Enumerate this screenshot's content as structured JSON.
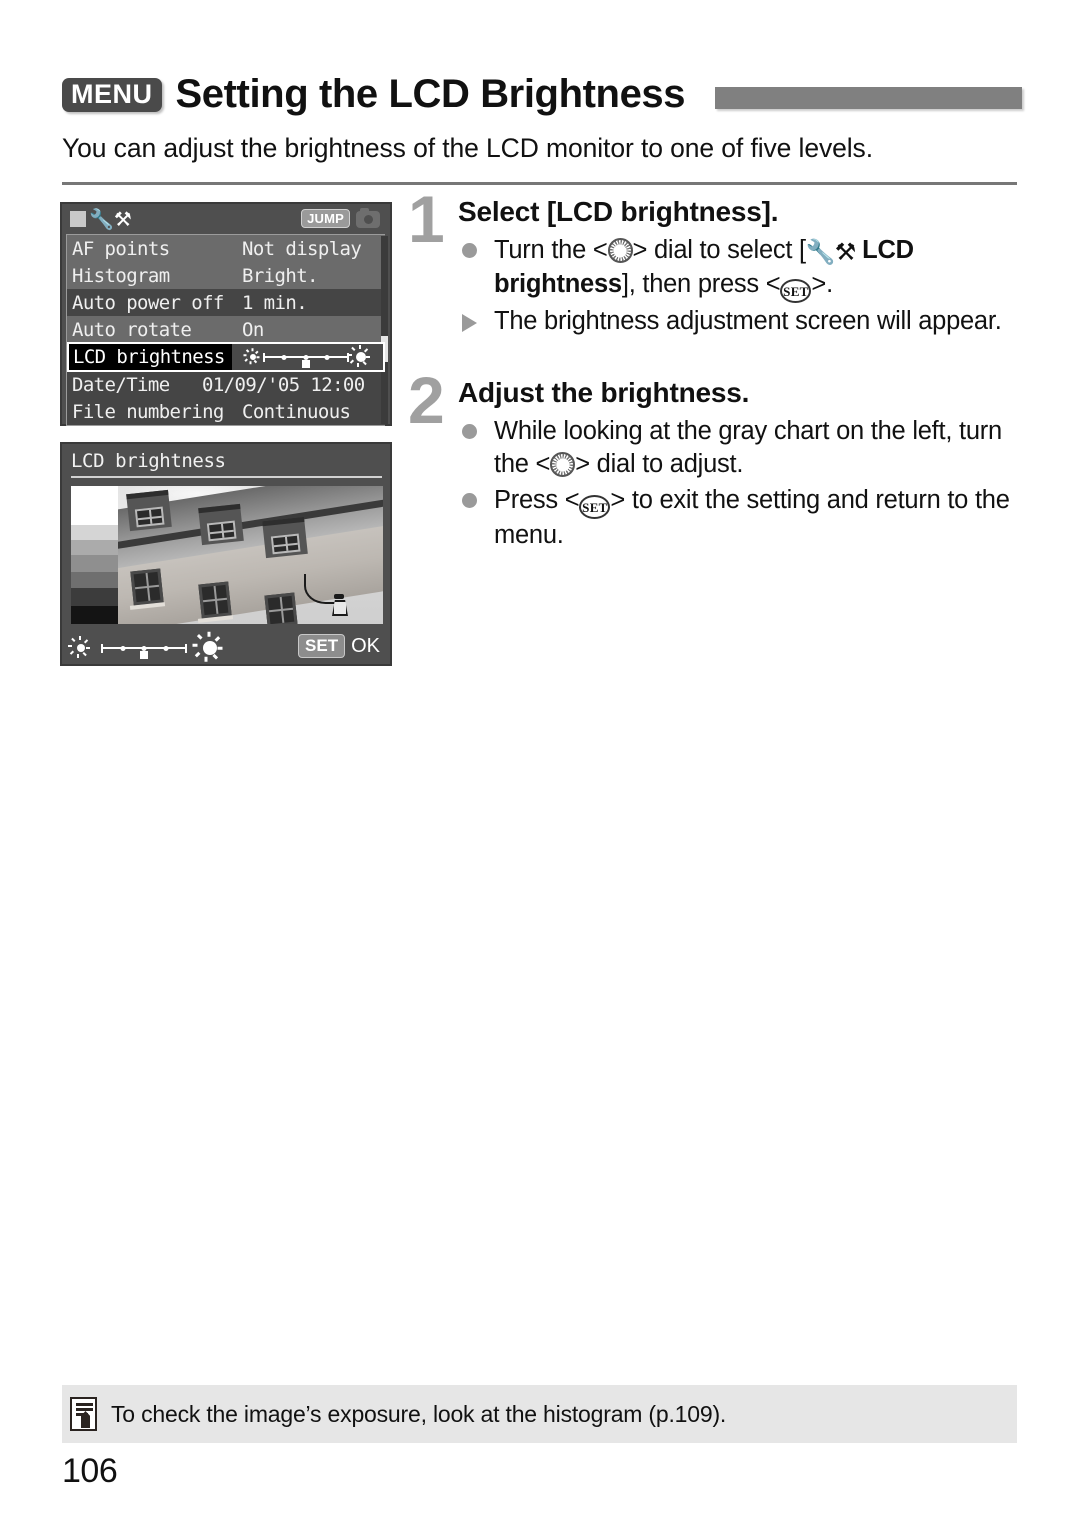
{
  "header": {
    "menu_badge": "MENU",
    "title": "Setting the LCD Brightness",
    "intro": "You can adjust the brightness of the LCD monitor to one of five levels."
  },
  "camera_menu_screen": {
    "tab_icons": [
      "setup-tab-square",
      "wrench-icon",
      "hammer-icon"
    ],
    "jump_badge": "JUMP",
    "camera_icon": "camera-icon",
    "rows": [
      {
        "label": "AF points",
        "value": "Not display",
        "selected": false
      },
      {
        "label": "Histogram",
        "value": "Bright.",
        "selected": false
      },
      {
        "label": "Auto power off",
        "value": "1 min.",
        "selected": false
      },
      {
        "label": "Auto rotate",
        "value": "On",
        "selected": false
      },
      {
        "label": "LCD brightness",
        "value": "brightness-slider",
        "selected": true
      },
      {
        "label": "Date/Time",
        "value": "01/09/'05 12:00",
        "selected": false
      },
      {
        "label": "File numbering",
        "value": "Continuous",
        "selected": false
      }
    ],
    "slider": {
      "levels": 5,
      "current": 3
    }
  },
  "camera_adjust_screen": {
    "title": "LCD brightness",
    "gray_chart_steps": [
      "#ffffff",
      "#d5d5d5",
      "#ababab",
      "#8f8f8f",
      "#6f6f6f",
      "#3c3c3c",
      "#141414"
    ],
    "photo_alt": "stone building with three dormer windows and a street lamp",
    "slider": {
      "levels": 5,
      "current": 3
    },
    "set_badge": "SET",
    "ok_label": "OK"
  },
  "steps": [
    {
      "number": "1",
      "title": "Select [LCD brightness].",
      "bullets": [
        {
          "marker": "dot",
          "segments": [
            {
              "t": "Turn the <",
              "style": "normal"
            },
            {
              "t": "dial-icon",
              "style": "icon-dial"
            },
            {
              "t": "> dial to select [",
              "style": "normal"
            },
            {
              "t": "setup-icon",
              "style": "icon-setup"
            },
            {
              "t": " LCD brightness",
              "style": "bold"
            },
            {
              "t": "], then press <",
              "style": "normal"
            },
            {
              "t": "set-icon",
              "style": "icon-set"
            },
            {
              "t": ">.",
              "style": "normal"
            }
          ]
        },
        {
          "marker": "triangle",
          "segments": [
            {
              "t": "The brightness adjustment screen will appear.",
              "style": "normal"
            }
          ]
        }
      ]
    },
    {
      "number": "2",
      "title": "Adjust the brightness.",
      "bullets": [
        {
          "marker": "dot",
          "segments": [
            {
              "t": "While looking at the gray chart on the left, turn the <",
              "style": "normal"
            },
            {
              "t": "dial-icon",
              "style": "icon-dial"
            },
            {
              "t": "> dial to adjust.",
              "style": "normal"
            }
          ]
        },
        {
          "marker": "dot",
          "segments": [
            {
              "t": "Press <",
              "style": "normal"
            },
            {
              "t": "set-icon",
              "style": "icon-set"
            },
            {
              "t": "> to exit the setting and return to the menu.",
              "style": "normal"
            }
          ]
        }
      ]
    }
  ],
  "note": {
    "icon": "note-pencil-icon",
    "text": "To check the image’s exposure, look at the histogram (p.109)."
  },
  "page_number": "106",
  "colors": {
    "accent_gray": "#808080",
    "screen_bg": "#4f4f4f",
    "row_light": "#6b6b6b",
    "row_dark": "#454545",
    "note_bg": "#e6e6e6"
  }
}
